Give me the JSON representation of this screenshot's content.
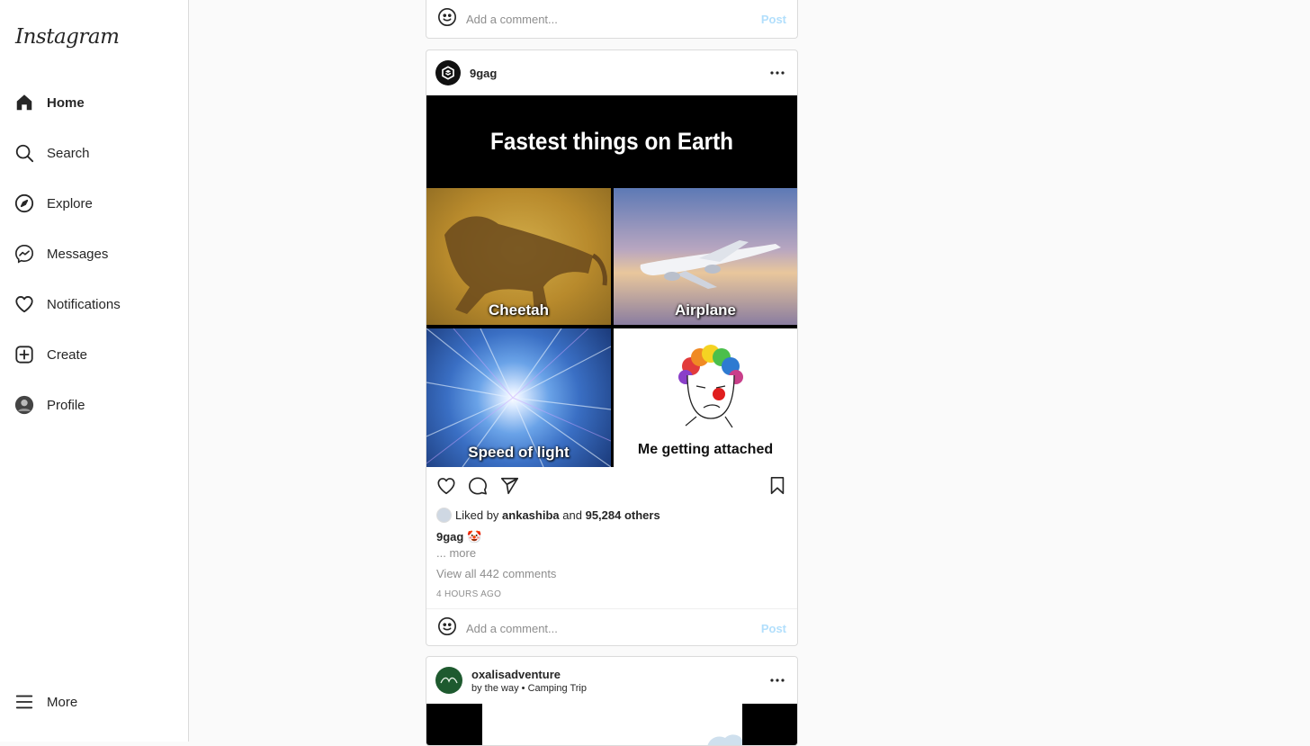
{
  "app": {
    "logo": "Instagram"
  },
  "sidebar": {
    "items": [
      {
        "label": "Home",
        "icon": "home-icon"
      },
      {
        "label": "Search",
        "icon": "search-icon"
      },
      {
        "label": "Explore",
        "icon": "compass-icon"
      },
      {
        "label": "Messages",
        "icon": "messenger-icon"
      },
      {
        "label": "Notifications",
        "icon": "heart-icon"
      },
      {
        "label": "Create",
        "icon": "plus-square-icon"
      },
      {
        "label": "Profile",
        "icon": "avatar"
      }
    ],
    "more_label": "More"
  },
  "top_comment_bar": {
    "placeholder": "Add a comment...",
    "post_label": "Post"
  },
  "post": {
    "username": "9gag",
    "meme": {
      "title": "Fastest things on Earth",
      "tiles": [
        "Cheetah",
        "Airplane",
        "Speed of light",
        "Me getting attached"
      ]
    },
    "liked_by_prefix": "Liked by",
    "liked_by_user": "ankashiba",
    "liked_and": "and",
    "liked_others": "95,284 others",
    "caption_user": "9gag",
    "caption_emoji": "🤡",
    "more_label": "... more",
    "view_comments": "View all 442 comments",
    "time": "4 HOURS AGO",
    "comment_placeholder": "Add a comment...",
    "post_label": "Post"
  },
  "next_post": {
    "username": "oxalisadventure",
    "subline_prefix": "by the way",
    "subline_sep": "•",
    "subline_suffix": "Camping Trip"
  },
  "colors": {
    "accent_disabled": "#b2dffc",
    "border": "#dbdbdb",
    "muted": "#8e8e8e"
  }
}
